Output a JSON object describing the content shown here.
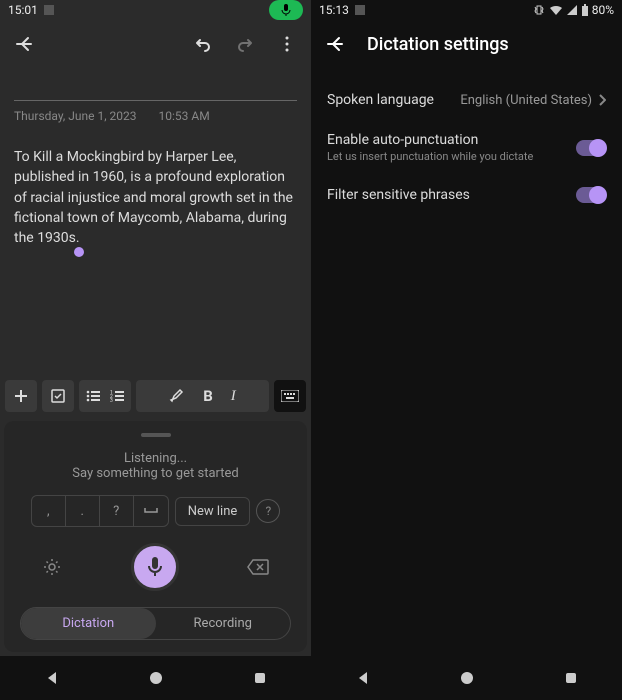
{
  "left": {
    "status": {
      "time": "15:01"
    },
    "note": {
      "date": "Thursday, June 1, 2023",
      "time": "10:53 AM",
      "text": "To Kill a Mockingbird by Harper Lee, published in 1960, is a profound exploration of racial injustice and moral growth set in the fictional town of Maycomb, Alabama, during the 1930s."
    },
    "dictation": {
      "title": "Listening...",
      "subtitle": "Say something to get started",
      "punct": [
        ",",
        ".",
        "?",
        "␣"
      ],
      "newline": "New line",
      "tabs": {
        "dictation": "Dictation",
        "recording": "Recording"
      }
    }
  },
  "right": {
    "status": {
      "time": "15:13",
      "battery": "80%"
    },
    "header": "Dictation settings",
    "rows": {
      "lang": {
        "label": "Spoken language",
        "value": "English (United States)"
      },
      "auto": {
        "label": "Enable auto-punctuation",
        "sub": "Let us insert punctuation while you dictate"
      },
      "filter": {
        "label": "Filter sensitive phrases"
      }
    }
  }
}
